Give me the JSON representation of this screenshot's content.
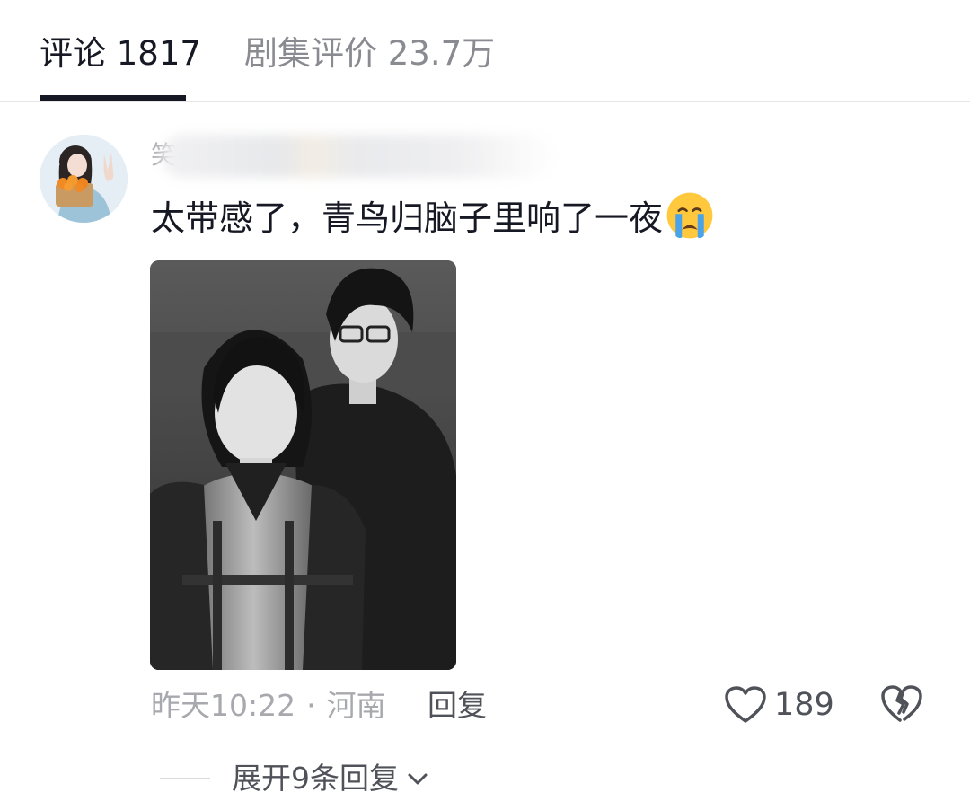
{
  "tabs": {
    "comments_label": "评论 1817",
    "reviews_label": "剧集评价 23.7万"
  },
  "comment": {
    "username_visible": "笑",
    "text": "太带感了，青鸟归脑子里响了一夜",
    "emoji": "crying-face-icon",
    "time": "昨天10:22",
    "separator": "·",
    "location": "河南",
    "reply_label": "回复",
    "like_count": "189",
    "like_icon": "heart-outline-icon",
    "dislike_icon": "broken-heart-icon",
    "expand_label": "展开9条回复",
    "expand_icon": "chevron-down-icon"
  },
  "colors": {
    "primary_text": "#161823",
    "secondary_text": "#a8a9ae",
    "tab_inactive": "#8a8b91",
    "action_text": "#505259"
  }
}
